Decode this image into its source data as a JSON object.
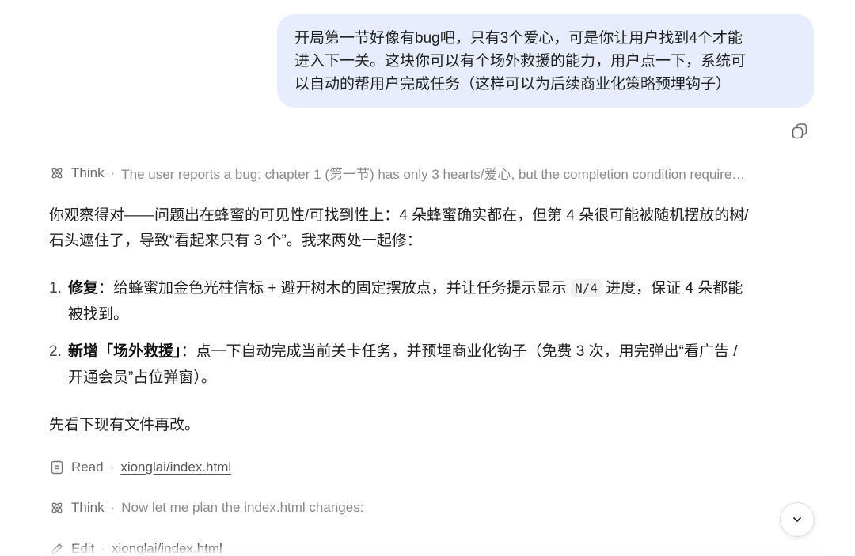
{
  "user_message": {
    "line1": "开局第一节好像有bug吧，只有3个爱心，可是你让用户找到4个才能",
    "line2": "进入下一关。这块你可以有个场外救援的能力，用户点一下，系统可",
    "line3": "以自动的帮用户完成任务（这样可以为后续商业化策略预埋钩子）"
  },
  "think_1": {
    "label": "Think",
    "separator": "·",
    "text": "The user reports a bug: chapter 1 (第一节) has only 3 hearts/爱心, but the completion condition require…"
  },
  "response": {
    "intro_line1": "你观察得对——问题出在蜂蜜的可见性/可找到性上：4 朵蜂蜜确实都在，但第 4 朵很可能被随机摆放的树/",
    "intro_line2": "石头遮住了，导致“看起来只有 3 个”。我来两处一起修：",
    "items": [
      {
        "num": "1.",
        "title": "修复",
        "text_before": "：给蜂蜜加金色光柱信标 + 避开树木的固定摆放点，并让任务提示显示 ",
        "code": "N/4",
        "text_after": " 进度，保证 4 朵都能",
        "text_line2": "被找到。"
      },
      {
        "num": "2.",
        "title": "新增「场外救援」",
        "text_before": "：点一下自动完成当前关卡任务，并预埋商业化钩子（免费 3 次，用完弹出“看广告 /",
        "text_line2": "开通会员”占位弹窗）。"
      }
    ],
    "outro": "先看下现有文件再改。"
  },
  "read_step": {
    "label": "Read",
    "separator": "·",
    "file": "xionglai/index.html"
  },
  "think_2": {
    "label": "Think",
    "separator": "·",
    "text": "Now let me plan the index.html changes:"
  },
  "edit_step": {
    "label": "Edit",
    "separator": "·",
    "file": "xionglai/index.html"
  },
  "icons": {
    "copy": "copy-icon",
    "think": "brain-icon",
    "read": "document-icon",
    "edit": "pencil-icon",
    "scroll_down": "chevron-down-icon"
  },
  "colors": {
    "user_bubble": "#e8edfd",
    "muted_text": "#7a7a7a",
    "body_text": "#1f1f1f"
  }
}
